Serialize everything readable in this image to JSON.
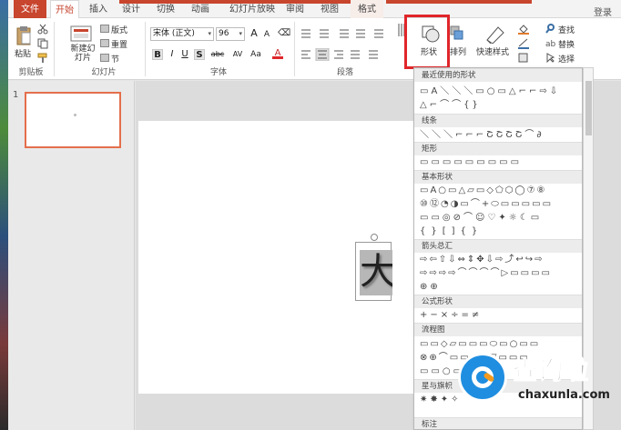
{
  "tabs": [
    "文件",
    "开始",
    "插入",
    "设计",
    "切换",
    "动画",
    "幻灯片放映",
    "审阅",
    "视图",
    "格式"
  ],
  "login": "登录",
  "clipboard": {
    "paste": "粘贴",
    "group": "剪贴板"
  },
  "slides": {
    "new_slide": "新建幻灯片",
    "layout": "版式",
    "reset": "重置",
    "section": "节",
    "group": "幻灯片"
  },
  "font": {
    "name": "宋体 (正文)",
    "size": "96",
    "group": "字体",
    "bold": "B",
    "italic": "I",
    "underline": "U",
    "shadow": "S",
    "strike": "abc",
    "spacing": "AV",
    "case": "Aa",
    "color": "A"
  },
  "paragraph": {
    "group": "段落"
  },
  "drawing": {
    "shapes": "形状",
    "arrange": "排列",
    "quick_styles": "快速样式"
  },
  "editing": {
    "find": "查找",
    "replace": "替换",
    "select": "选择"
  },
  "slide_number": "1",
  "textbox_char": "大",
  "gallery": {
    "sections": [
      "最近使用的形状",
      "线条",
      "矩形",
      "基本形状",
      "箭头总汇",
      "公式形状",
      "流程图",
      "星与旗帜",
      "标注"
    ],
    "recent_row1": "▭A＼＼＼▭○▭△⌐⌐⇨⇩",
    "recent_row2": "△⌐⌒⌒{}",
    "lines_row": "＼＼＼⌐⌐⌐ՇՇՇՇ⌒∂",
    "rect_row": "▭▭▭▭▭▭▭▭▭",
    "basic_row1": "▭A○▭△▱▭◇⬠⬡◯⑦⑧",
    "basic_row2": "⑩⑫◔◑▭⌒+⬭▭▭▭▭▭",
    "basic_row3": "▭▭◎⊘⌒☺♡✦☼☾▭",
    "basic_row4": "{}[]{}",
    "arrows_row1": "⇨⇦⇧⇩⇔⇕✥⇩⇨⤴↩↪⇨",
    "arrows_row2": "⇨⇨⇨⇨⌒⌒⌒⌒▷▭▭▭▭",
    "arrows_row3": "⊕⊕",
    "math_row": "+−×÷=≠",
    "flow_row1": "▭▭◇▱▭▭▭⬭▭○▭▭",
    "flow_row2": "⊗⊕⌒▭▭▭▽▽▭▭▭",
    "flow_row3": "▭▭○▭",
    "stars_row": "✷✸✦✧"
  },
  "watermark": {
    "cn": "查询啦",
    "en": "chaxunla.com"
  },
  "colors": {
    "accent": "#c8452e",
    "highlight": "#e0262a"
  }
}
